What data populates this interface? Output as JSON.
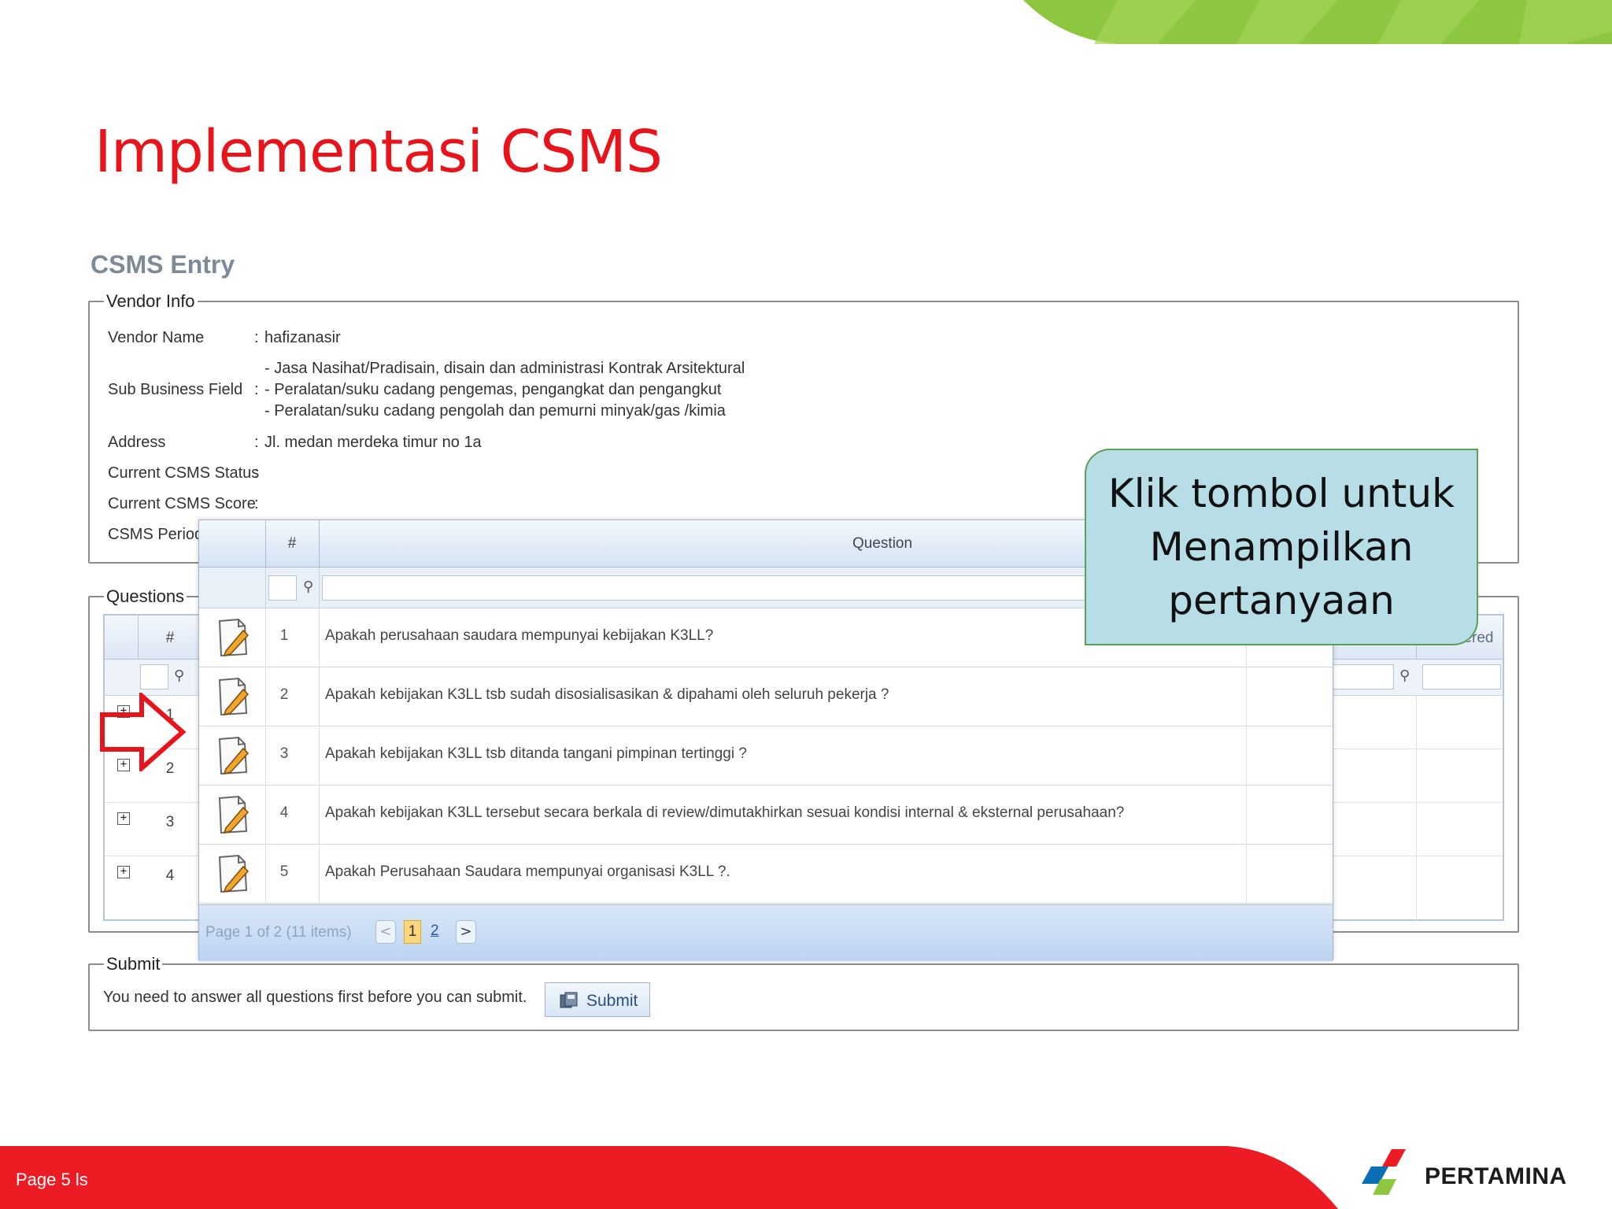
{
  "slide": {
    "title": "Implementasi CSMS",
    "page_label": "Page  5 ls",
    "brand": "PERTAMINA"
  },
  "csms": {
    "entry_title": "CSMS Entry",
    "vendor_info": {
      "legend": "Vendor Info",
      "rows": [
        {
          "label": "Vendor Name",
          "colon": ":",
          "value": "hafizanasir"
        },
        {
          "label": "Sub Business Field",
          "colon": ":",
          "values": [
            "- Jasa Nasihat/Pradisain, disain dan administrasi Kontrak Arsitektural",
            "- Peralatan/suku cadang pengemas, pengangkat dan pengangkut",
            "- Peralatan/suku cadang pengolah dan pemurni minyak/gas /kimia"
          ]
        },
        {
          "label": "Address",
          "colon": ":",
          "value": "Jl. medan merdeka timur no 1a"
        },
        {
          "label": "Current CSMS Status",
          "colon": ":",
          "value": ""
        },
        {
          "label": "Current CSMS Score",
          "colon": ":",
          "value": ""
        },
        {
          "label": "CSMS Period",
          "colon": "",
          "value": ""
        }
      ]
    },
    "questions_group": {
      "legend": "Questions",
      "header_num": "#",
      "header_answered": "Answered",
      "rows": [
        "1",
        "2",
        "3",
        "4"
      ]
    },
    "popup": {
      "header_num": "#",
      "header_question": "Question",
      "rows": [
        {
          "num": "1",
          "question": "Apakah perusahaan saudara mempunyai kebijakan K3LL?"
        },
        {
          "num": "2",
          "question": "Apakah kebijakan K3LL tsb sudah disosialisasikan & dipahami oleh seluruh pekerja ?"
        },
        {
          "num": "3",
          "question": "Apakah kebijakan K3LL tsb ditanda tangani pimpinan tertinggi ?"
        },
        {
          "num": "4",
          "question": "Apakah kebijakan K3LL tersebut secara berkala di review/dimutakhirkan sesuai kondisi internal & eksternal perusahaan?"
        },
        {
          "num": "5",
          "question": "Apakah Perusahaan Saudara mempunyai organisasi K3LL ?."
        }
      ],
      "pager": {
        "text": "Page 1 of 2 (11 items)",
        "prev": "<",
        "page1": "1",
        "page2": "2",
        "next": ">"
      }
    },
    "submit": {
      "legend": "Submit",
      "message": "You need to answer all questions first before you can submit.",
      "button_label": "Submit"
    }
  },
  "callout": {
    "text": "Klik tombol untuk Menampilkan pertanyaan"
  },
  "colors": {
    "title_red": "#e8141b",
    "footer_red": "#ed1c24",
    "deco_green": "#8dc63f",
    "callout_bg": "#b7dde6",
    "callout_border": "#5aa05a"
  },
  "icons": [
    "edit-icon",
    "filter-icon",
    "expand-icon",
    "submit-icon",
    "red-arrow",
    "pertamina-logo"
  ]
}
